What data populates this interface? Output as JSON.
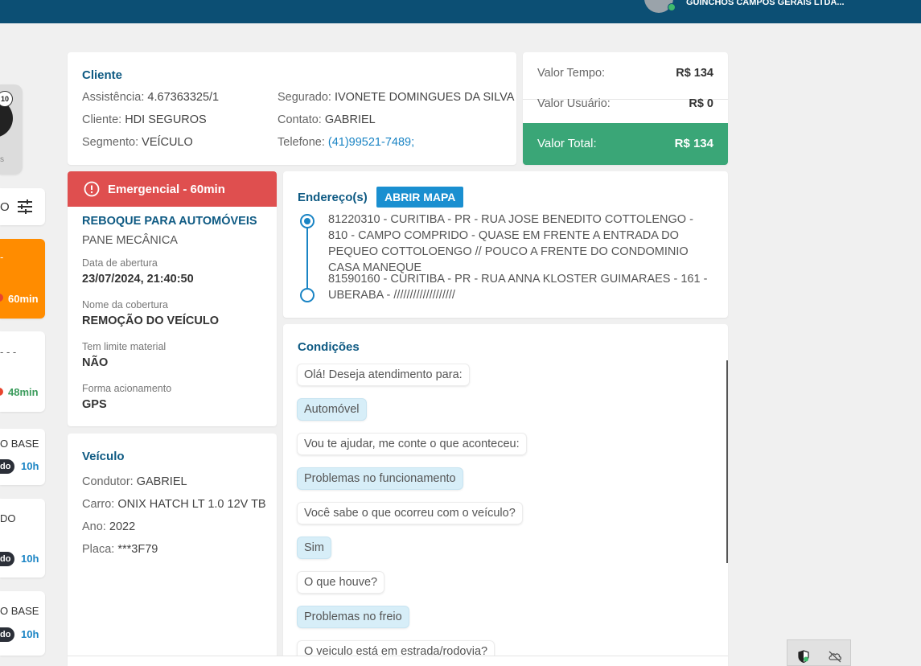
{
  "header": {
    "company_name": "GUINCHOS CAMPOS GERAIS LTDA..."
  },
  "left_column": {
    "profile_badge": "10",
    "profile_caption": "s",
    "filter_label": "O",
    "cards": [
      {
        "line": "-",
        "time": "60min"
      },
      {
        "line": "- - -",
        "time": "48min"
      },
      {
        "line": "O BASE",
        "status": "do",
        "hours": "10h"
      },
      {
        "line": "DO",
        "status": "do",
        "hours": "10h"
      },
      {
        "line": "O BASE",
        "status": "do",
        "hours": "10h"
      }
    ]
  },
  "cliente": {
    "title": "Cliente",
    "assistencia_label": "Assistência:",
    "assistencia_value": "4.67363325/1",
    "cliente_label": "Cliente:",
    "cliente_value": "HDI SEGUROS",
    "segmento_label": "Segmento:",
    "segmento_value": "VEÍCULO",
    "segurado_label": "Segurado:",
    "segurado_value": "IVONETE DOMINGUES DA SILVA",
    "contato_label": "Contato:",
    "contato_value": "GABRIEL",
    "telefone_label": "Telefone:",
    "telefone_value": "(41)99521-7489;"
  },
  "valores": {
    "tempo_label": "Valor Tempo:",
    "tempo_value": "R$ 134",
    "usuario_label": "Valor Usuário:",
    "usuario_value": "R$ 0",
    "total_label": "Valor Total:",
    "total_value": "R$ 134",
    "total_color": "#3aa677"
  },
  "servico": {
    "priority": "Emergencial - 60min",
    "priority_color": "#df4f4f",
    "title": "REBOQUE PARA AUTOMÓVEIS",
    "subtitle": "PANE MECÂNICA",
    "abertura_label": "Data de abertura",
    "abertura_value": "23/07/2024, 21:40:50",
    "cobertura_label": "Nome da cobertura",
    "cobertura_value": "REMOÇÃO DO VEÍCULO",
    "limite_label": "Tem limite material",
    "limite_value": "NÃO",
    "acionamento_label": "Forma acionamento",
    "acionamento_value": "GPS"
  },
  "veiculo": {
    "title": "Veículo",
    "condutor_label": "Condutor:",
    "condutor_value": "GABRIEL",
    "carro_label": "Carro:",
    "carro_value": "ONIX HATCH LT 1.0 12V TB",
    "ano_label": "Ano:",
    "ano_value": "2022",
    "placa_label": "Placa:",
    "placa_value": "***3F79"
  },
  "enderecos": {
    "title": "Endereço(s)",
    "map_button": "ABRIR MAPA",
    "origin": "81220310 - CURITIBA - PR - RUA JOSE BENEDITO COTTOLENGO - 810 - CAMPO COMPRIDO - QUASE EM FRENTE A ENTRADA DO PEQUEO COTTOLOENGO // POUCO A FRENTE DO CONDOMINIO CASA MANEQUE",
    "destination": "81590160 - CURITIBA - PR - RUA ANNA KLOSTER GUIMARAES - 161 - UBERABA - ///////////////////"
  },
  "condicoes": {
    "title": "Condições",
    "messages": [
      {
        "text": "Olá! Deseja atendimento para:",
        "type": "question"
      },
      {
        "text": "Automóvel",
        "type": "answer"
      },
      {
        "text": "Vou te ajudar, me conte o que aconteceu:",
        "type": "question"
      },
      {
        "text": "Problemas no funcionamento",
        "type": "answer"
      },
      {
        "text": "Você sabe o que ocorreu com o veículo?",
        "type": "question"
      },
      {
        "text": "Sim",
        "type": "answer"
      },
      {
        "text": "O que houve?",
        "type": "question"
      },
      {
        "text": "Problemas no freio",
        "type": "answer"
      },
      {
        "text": "O veiculo está em estrada/rodovia?",
        "type": "question"
      }
    ]
  }
}
